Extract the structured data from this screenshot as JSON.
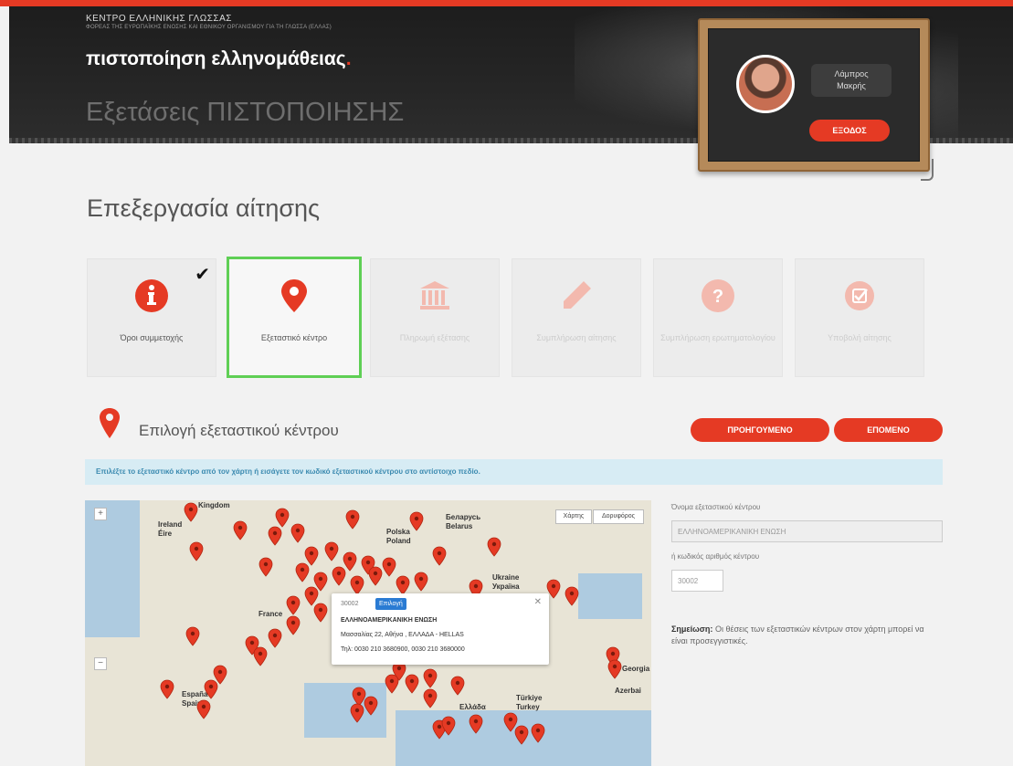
{
  "header": {
    "org_name": "ΚΕΝΤΡΟ ΕΛΛΗΝΙΚΗΣ ΓΛΩΣΣΑΣ",
    "org_subtitle": "ΦΟΡΕΑΣ ΤΗΣ ΕΥΡΩΠΑΪΚΗΣ ΕΝΟΣΗΣ ΚΑΙ ΕΘΝΙΚΟΥ ΟΡΓΑΝΙΣΜΟΥ ΓΙΑ ΤΗ ΓΛΩΣΣΑ (ΕΛΛΑΣ)",
    "site_title": "πιστοποίηση ελληνομάθειας",
    "site_title_dot": ".",
    "exam_title": "Εξετάσεις ΠΙΣΤΟΠΟΙΗΣΗΣ"
  },
  "user": {
    "first_name": "Λάμπρος",
    "last_name": "Μακρής",
    "logout_label": "ΕΞΟΔΟΣ"
  },
  "page": {
    "title": "Επεξεργασία αίτησης"
  },
  "steps": [
    {
      "label": "Όροι συμμετοχής",
      "icon": "info-icon",
      "state": "done"
    },
    {
      "label": "Εξεταστικό κέντρο",
      "icon": "map-marker-icon",
      "state": "active"
    },
    {
      "label": "Πληρωμή εξέτασης",
      "icon": "bank-icon",
      "state": "pending"
    },
    {
      "label": "Συμπλήρωση αίτησης",
      "icon": "pencil-icon",
      "state": "pending"
    },
    {
      "label": "Συμπλήρωση ερωτηματολογίου",
      "icon": "question-icon",
      "state": "pending"
    },
    {
      "label": "Υποβολή αίτησης",
      "icon": "check-square-icon",
      "state": "pending"
    }
  ],
  "section": {
    "title": "Επιλογή εξεταστικού κέντρου",
    "prev_label": "ΠΡΟΗΓΟΥΜΕΝΟ",
    "next_label": "ΕΠΟΜΕΝΟ",
    "info": "Επιλέξτε το εξεταστικό κέντρο από τον χάρτη ή εισάγετε τον κωδικό εξεταστικού κέντρου στο αντίστοιχο πεδίο."
  },
  "map": {
    "type_map": "Χάρτης",
    "type_satellite": "Δορυφόρος",
    "labels": [
      "Kingdom",
      "Ireland",
      "Éire",
      "Polska",
      "Poland",
      "Belarus",
      "Беларусь",
      "Ukraine",
      "Україна",
      "France",
      "España",
      "Spain",
      "Türkiye",
      "Turkey",
      "Ελλάδα",
      "Georgia",
      "Azerbai"
    ],
    "popup": {
      "code": "30002",
      "select_label": "Επιλογή",
      "name": "ΕΛΛΗΝΟΑΜΕΡΙΚΑΝΙΚΗ ΕΝΩΣΗ",
      "address": "Μασσαλίας 22, Αθήνα , ΕΛΛΑΔΑ - HELLAS",
      "phone": "Τηλ: 0030 210 3680900, 0030 210 3680000"
    }
  },
  "form": {
    "name_label": "Όνομα εξεταστικού κέντρου",
    "name_value": "ΕΛΛΗΝΟΑΜΕΡΙΚΑΝΙΚΗ ΕΝΩΣΗ",
    "code_label": "ή κωδικός αριθμός κέντρου",
    "code_value": "30002",
    "note_strong": "Σημείωση:",
    "note_text": " Οι θέσεις των εξεταστικών κέντρων στον χάρτη μπορεί να είναι προσεγγιστικές."
  },
  "colors": {
    "brand_red": "#e53a24",
    "active_green": "#5fcf55",
    "info_blue": "#d7ecf4"
  }
}
